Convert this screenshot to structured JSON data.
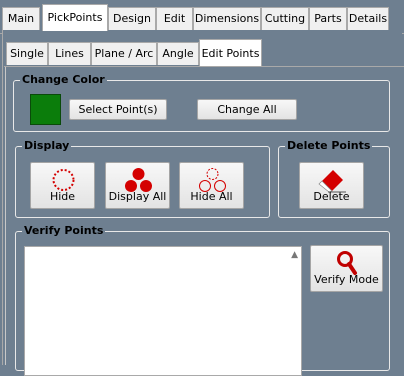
{
  "top_tabs": [
    "Main",
    "PickPoints",
    "Design",
    "Edit",
    "Dimensions",
    "Cutting",
    "Parts",
    "Details"
  ],
  "sub_tabs": [
    "Single",
    "Lines",
    "Plane / Arc",
    "Angle",
    "Edit Points"
  ],
  "change_color": {
    "title": "Change Color",
    "swatch_color": "#0b7d0b",
    "select_points": "Select Point(s)",
    "change_all": "Change All"
  },
  "display": {
    "title": "Display",
    "hide": "Hide",
    "display_all": "Display All",
    "hide_all": "Hide All"
  },
  "delete_points": {
    "title": "Delete Points",
    "delete": "Delete"
  },
  "verify_points": {
    "title": "Verify Points",
    "verify_mode": "Verify Mode"
  },
  "colors": {
    "background": "#6e7f90",
    "point_red": "#d40000"
  }
}
